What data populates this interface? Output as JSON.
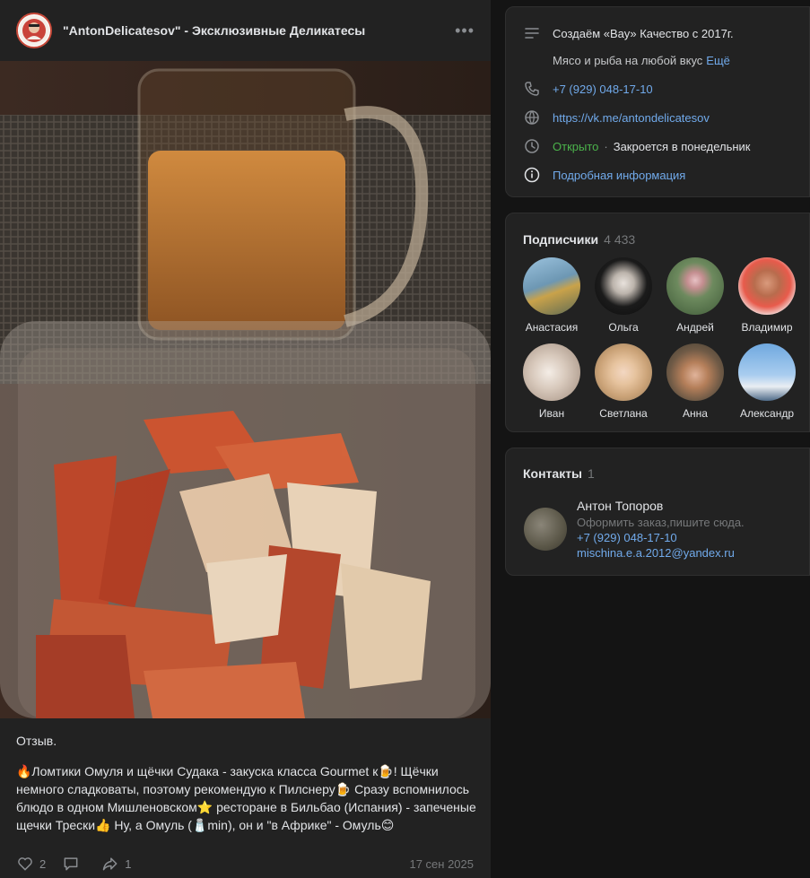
{
  "post": {
    "group_name": "\"AntonDelicatesov\" - Эксклюзивные Деликатесы",
    "more_glyph": "•••",
    "text_title": "Отзыв.",
    "text_body": "🔥Ломтики Омуля и щёчки Судака - закуска класса Gourmet к🍺! Щёчки немного сладковаты, поэтому рекомендую к Пилснеру🍺 Сразу вспомнилось блюдо в одном Мишленовском⭐ ресторане в Бильбао (Испания) - запеченые щечки Трески👍 Ну, а Омуль (🧂min), он и \"в Африке\" - Омуль😊",
    "likes": "2",
    "comments": "",
    "shares": "1",
    "date": "17 сен 2025"
  },
  "info": {
    "status": "Создаём «Вау» Качество с 2017г.",
    "description": "Мясо и рыба на любой вкус",
    "more_link": "Ещё",
    "phone": "+7 (929) 048-17-10",
    "url": "https://vk.me/antondelicatesov",
    "open_status": "Открыто",
    "close_text": "Закроется в понедельник",
    "details_link": "Подробная информация",
    "icons": [
      "list-icon",
      "phone-icon",
      "globe-icon",
      "clock-icon",
      "info-icon"
    ]
  },
  "subscribers": {
    "title": "Подписчики",
    "count": "4 433",
    "people": [
      {
        "name": "Анастасия"
      },
      {
        "name": "Ольга"
      },
      {
        "name": "Андрей"
      },
      {
        "name": "Владимир"
      },
      {
        "name": "Иван"
      },
      {
        "name": "Светлана"
      },
      {
        "name": "Анна"
      },
      {
        "name": "Александр"
      }
    ]
  },
  "contacts": {
    "title": "Контакты",
    "count": "1",
    "name": "Антон Топоров",
    "description": "Оформить заказ,пишите сюда.",
    "phone": "+7 (929) 048-17-10",
    "email": "mischina.e.a.2012@yandex.ru"
  },
  "colors": {
    "background": "#141414",
    "card": "#222222",
    "link": "#71aaeb",
    "open_green": "#4bb34b",
    "muted": "#8a8d91"
  }
}
